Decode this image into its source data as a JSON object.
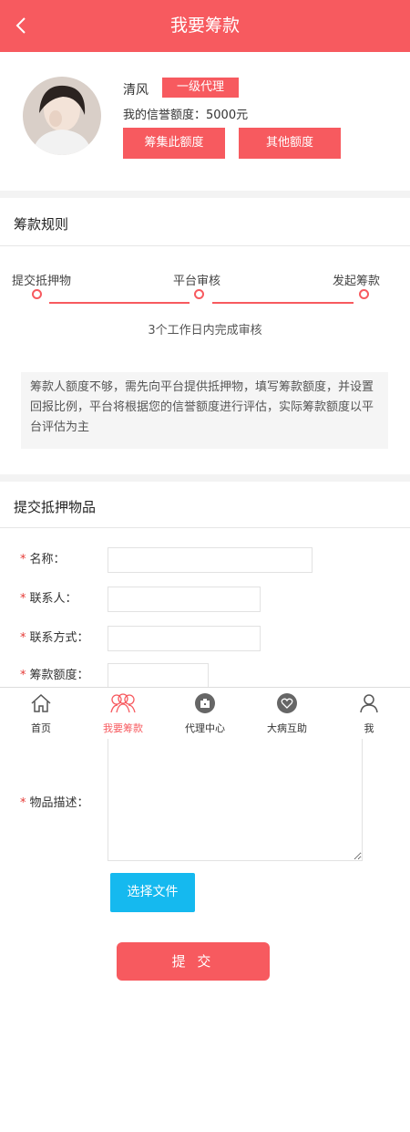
{
  "header": {
    "title": "我要筹款"
  },
  "profile": {
    "name": "清风",
    "level": "一级代理",
    "credit_text": "我的信誉额度：5000元",
    "raise_button": "筹集此额度",
    "other_button": "其他额度"
  },
  "rules": {
    "title": "筹款规则",
    "steps": [
      "提交抵押物",
      "平台审核",
      "发起筹款"
    ],
    "step_note": "3个工作日内完成审核",
    "description": "筹款人额度不够，需先向平台提供抵押物，填写筹款额度，并设置回报比例，平台将根据您的信誉额度进行评估，实际筹款额度以平台评估为主"
  },
  "form": {
    "title": "提交抵押物品",
    "required_mark": "*",
    "fields": [
      {
        "label": "名称：",
        "value": ""
      },
      {
        "label": "联系人：",
        "value": ""
      },
      {
        "label": "联系方式：",
        "value": ""
      },
      {
        "label": "筹款额度：",
        "value": ""
      }
    ],
    "description_label": "物品描述：",
    "file_button": "选择文件",
    "submit_button": "提 交"
  },
  "tabbar": {
    "items": [
      {
        "label": "首页",
        "icon": "home-icon"
      },
      {
        "label": "我要筹款",
        "icon": "fundraise-icon",
        "active": true
      },
      {
        "label": "代理中心",
        "icon": "agent-center-icon"
      },
      {
        "label": "大病互助",
        "icon": "mutual-aid-icon"
      },
      {
        "label": "我",
        "icon": "user-icon"
      }
    ]
  },
  "colors": {
    "accent": "#f75a5f",
    "file_button": "#15b9ef"
  }
}
